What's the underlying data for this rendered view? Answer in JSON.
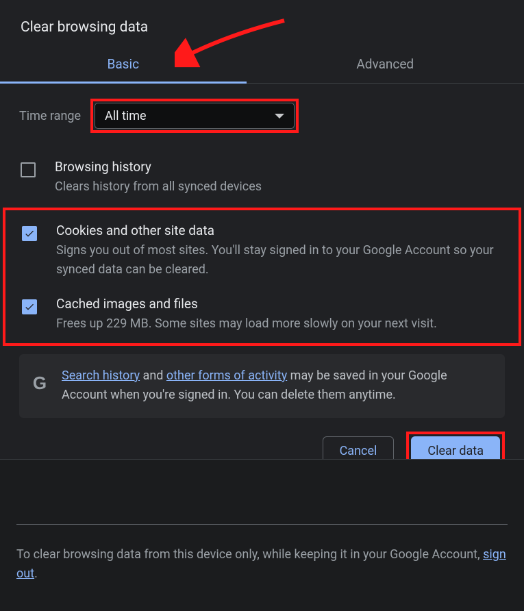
{
  "title": "Clear browsing data",
  "tabs": {
    "basic": "Basic",
    "advanced": "Advanced"
  },
  "timeRange": {
    "label": "Time range",
    "value": "All time"
  },
  "options": {
    "browsing": {
      "label": "Browsing history",
      "desc": "Clears history from all synced devices",
      "checked": false
    },
    "cookies": {
      "label": "Cookies and other site data",
      "desc": "Signs you out of most sites. You'll stay signed in to your Google Account so your synced data can be cleared.",
      "checked": true
    },
    "cache": {
      "label": "Cached images and files",
      "desc": "Frees up 229 MB. Some sites may load more slowly on your next visit.",
      "checked": true
    }
  },
  "info": {
    "link1": "Search history",
    "mid1": " and ",
    "link2": "other forms of activity",
    "rest": " may be saved in your Google Account when you're signed in. You can delete them anytime."
  },
  "buttons": {
    "cancel": "Cancel",
    "clear": "Clear data"
  },
  "footer": {
    "text1": "To clear browsing data from this device only, while keeping it in your Google Account, ",
    "signout": "sign out",
    "text2": "."
  },
  "annotations": {
    "arrow_color": "#ff1a1a",
    "box_color": "#ff1a1a"
  }
}
